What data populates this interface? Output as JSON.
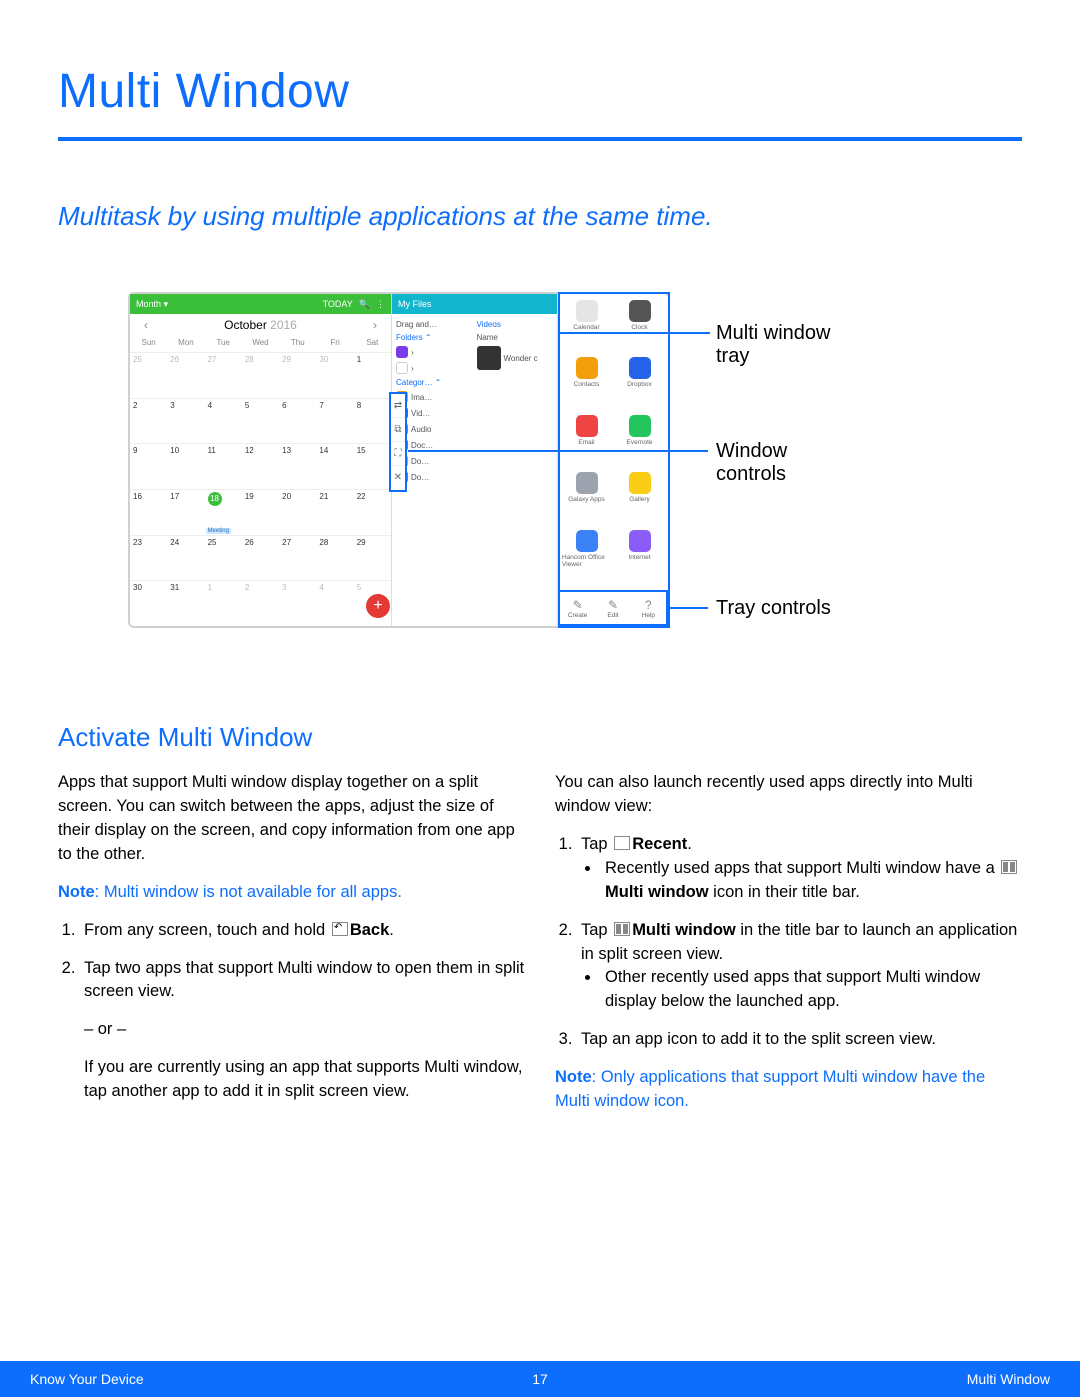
{
  "title": "Multi Window",
  "subtitle": "Multitask by using multiple applications at the same time.",
  "figure": {
    "callouts": {
      "tray": "Multi window tray",
      "window_controls": "Window controls",
      "tray_controls": "Tray controls"
    },
    "calendar": {
      "view_label": "Month ▾",
      "today": "TODAY",
      "month": "October",
      "year": "2016",
      "day_headers": [
        "Sun",
        "Mon",
        "Tue",
        "Wed",
        "Thu",
        "Fri",
        "Sat"
      ],
      "weeks": [
        [
          "25",
          "26",
          "27",
          "28",
          "29",
          "30",
          "1"
        ],
        [
          "2",
          "3",
          "4",
          "5",
          "6",
          "7",
          "8"
        ],
        [
          "9",
          "10",
          "11",
          "12",
          "13",
          "14",
          "15"
        ],
        [
          "16",
          "17",
          "18",
          "19",
          "20",
          "21",
          "22"
        ],
        [
          "23",
          "24",
          "25",
          "26",
          "27",
          "28",
          "29"
        ],
        [
          "30",
          "31",
          "1",
          "2",
          "3",
          "4",
          "5"
        ]
      ],
      "event_label": "Meeting",
      "fab": "+"
    },
    "myfiles": {
      "title": "My Files",
      "drag": "Drag and…",
      "folders": "Folders   ⌃",
      "categ": "Categor…  ⌃",
      "items_left": [
        "Ima…",
        "Vid…",
        "Audio",
        "Doc…",
        "Do…",
        "Do…"
      ],
      "videos": "Videos",
      "name": "Name",
      "wonder": "Wonder c"
    },
    "tray_apps": [
      {
        "label": "Calendar",
        "color": "#e5e5e5"
      },
      {
        "label": "Clock",
        "color": "#555"
      },
      {
        "label": "Contacts",
        "color": "#f59e0b"
      },
      {
        "label": "Dropbox",
        "color": "#2563eb"
      },
      {
        "label": "Email",
        "color": "#ef4444"
      },
      {
        "label": "Evernote",
        "color": "#22c55e"
      },
      {
        "label": "Galaxy Apps",
        "color": "#9ca3af"
      },
      {
        "label": "Gallery",
        "color": "#facc15"
      },
      {
        "label": "Hancom Office Viewer",
        "color": "#3b82f6"
      },
      {
        "label": "Internet",
        "color": "#8b5cf6"
      }
    ],
    "tray_controls": [
      "Create",
      "Edit",
      "Help"
    ]
  },
  "section_heading": "Activate Multi Window",
  "left_col": {
    "intro": "Apps that support Multi window display together on a split screen. You can switch between the apps, adjust the size of their display on the screen, and copy information from one app to the other.",
    "note_prefix": "Note",
    "note_text": ": Multi window is not available for all apps.",
    "step1_a": "From any screen, touch and hold ",
    "step1_b": "Back",
    "step1_c": ".",
    "step2": "Tap two apps that support Multi window to open them in split screen view.",
    "or": "– or –",
    "or_text": "If you are currently using an app that supports Multi window, tap another app to add it in split screen view."
  },
  "right_col": {
    "intro": "You can also launch recently used apps directly into Multi window view:",
    "step1_a": "Tap ",
    "step1_b": "Recent",
    "step1_c": ".",
    "bullet1_a": "Recently used apps that support Multi window have a ",
    "bullet1_b": "Multi window",
    "bullet1_c": " icon in their title bar.",
    "step2_a": "Tap ",
    "step2_b": "Multi window",
    "step2_c": " in the title bar to launch an application in split screen view.",
    "bullet2": "Other recently used apps that support Multi window display below the launched app.",
    "step3": "Tap an app icon to add it to the split screen view.",
    "note_prefix": "Note",
    "note_text": ": Only applications that support Multi window have the Multi window icon."
  },
  "footer": {
    "left": "Know Your Device",
    "page": "17",
    "right": "Multi Window"
  }
}
